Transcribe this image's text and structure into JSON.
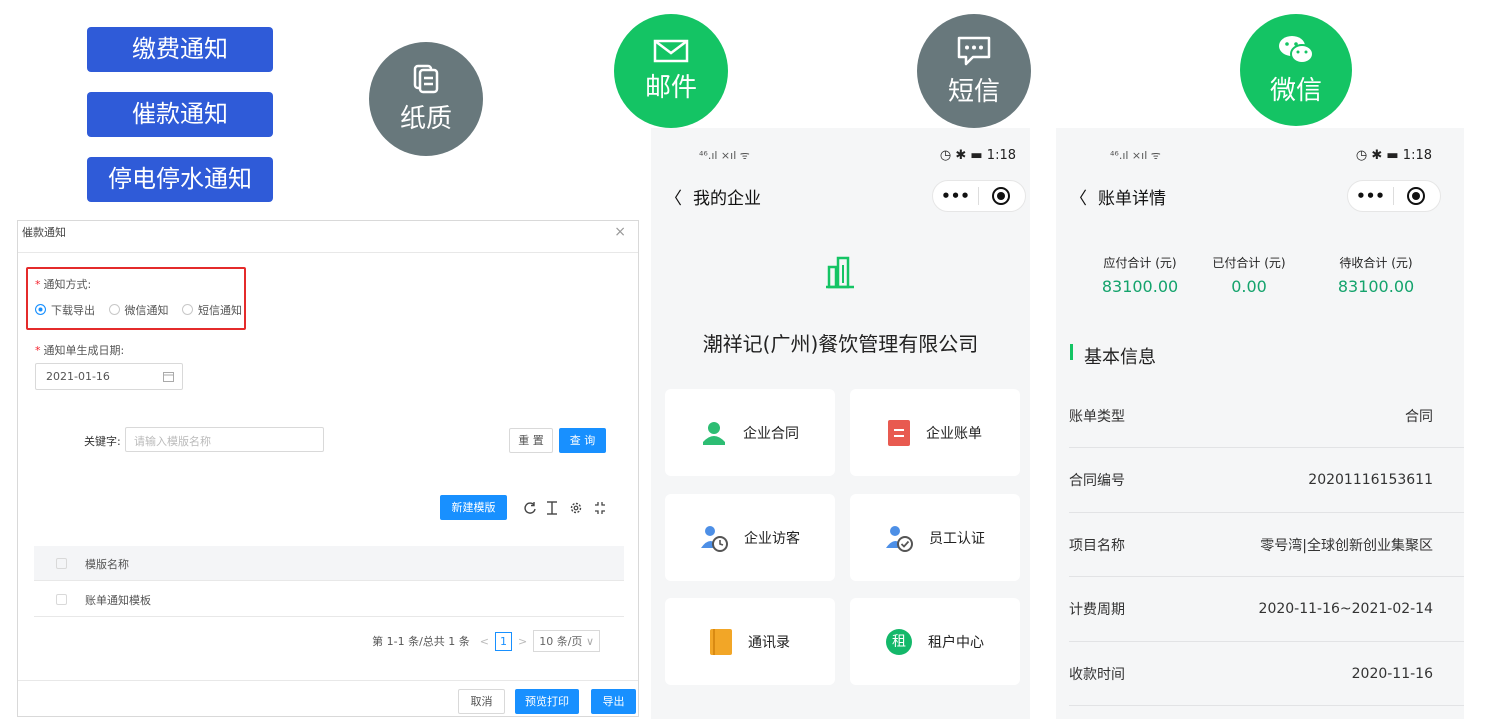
{
  "notice_types": [
    "缴费通知",
    "催款通知",
    "停电停水通知"
  ],
  "channels": {
    "paper": "纸质",
    "email": "邮件",
    "sms": "短信",
    "wechat": "微信"
  },
  "dialog": {
    "title": "催款通知",
    "close": "×",
    "notify_method_label": "通知方式:",
    "options": [
      "下载导出",
      "微信通知",
      "短信通知"
    ],
    "date_label": "通知单生成日期:",
    "date_value": "2021-01-16",
    "keyword_label": "关键字:",
    "keyword_placeholder": "请输入模版名称",
    "reset_btn": "重 置",
    "query_btn": "查 询",
    "new_template_btn": "新建模版",
    "table_header": "模版名称",
    "table_row": "账单通知模板",
    "pager_info": "第 1-1 条/总共 1 条",
    "pager_page": "1",
    "pager_size": "10 条/页",
    "cancel_btn": "取消",
    "preview_btn": "预览打印",
    "export_btn": "导出"
  },
  "phone1": {
    "time": "1:18",
    "title": "我的企业",
    "company": "潮祥记(广州)餐饮管理有限公司",
    "cards": [
      "企业合同",
      "企业账单",
      "企业访客",
      "员工认证",
      "通讯录",
      "租户中心"
    ],
    "rent_char": "租"
  },
  "phone2": {
    "time": "1:18",
    "title": "账单详情",
    "sums": [
      {
        "label": "应付合计 (元)",
        "value": "83100.00"
      },
      {
        "label": "已付合计 (元)",
        "value": "0.00"
      },
      {
        "label": "待收合计 (元)",
        "value": "83100.00"
      }
    ],
    "section": "基本信息",
    "rows": [
      {
        "k": "账单类型",
        "v": "合同"
      },
      {
        "k": "合同编号",
        "v": "20201116153611"
      },
      {
        "k": "项目名称",
        "v": "零号湾|全球创新创业集聚区"
      },
      {
        "k": "计费周期",
        "v": "2020-11-16~2021-02-14"
      },
      {
        "k": "收款时间",
        "v": "2020-11-16"
      }
    ]
  },
  "colors": {
    "tag_blue": "#2f5bd8",
    "gray": "#68787c",
    "green": "#14c464",
    "value_green": "#14a36c",
    "primary": "#1890ff",
    "highlight": "#e42b2b"
  }
}
